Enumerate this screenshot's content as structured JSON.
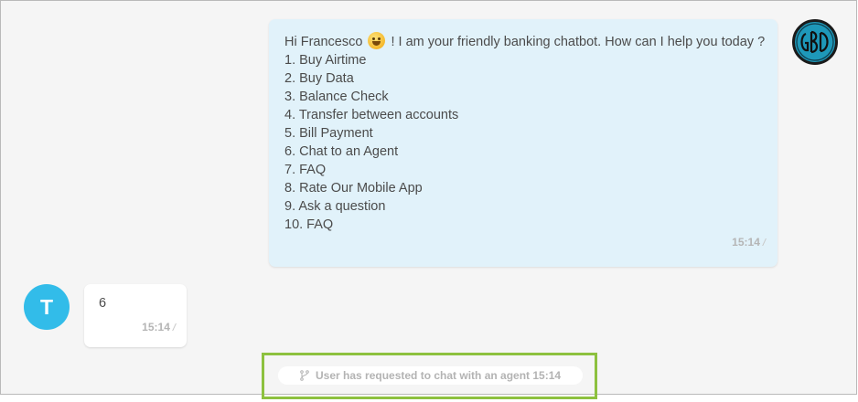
{
  "bot": {
    "avatar_icon": "bank-logo-icon",
    "greeting_before_emoji": "Hi Francesco",
    "greeting_emoji": "grinning-face-emoji",
    "greeting_after_emoji": "! I am your friendly banking chatbot. How can I help you today ?",
    "menu_items": [
      "1. Buy Airtime",
      "2. Buy Data",
      "3. Balance Check",
      "4. Transfer between accounts",
      "5. Bill Payment",
      "6. Chat to an Agent",
      "7. FAQ",
      "8. Rate Our Mobile App",
      "9. Ask a question",
      "10. FAQ"
    ],
    "timestamp": "15:14",
    "bubble_color": "#e1f2fa"
  },
  "user": {
    "avatar_initial": "T",
    "avatar_color": "#32bce9",
    "message": "6",
    "timestamp": "15:14"
  },
  "system_event": {
    "icon": "git-branch-icon",
    "text": "User has requested to chat with an agent 15:14",
    "highlight_color": "#8dc13f"
  }
}
